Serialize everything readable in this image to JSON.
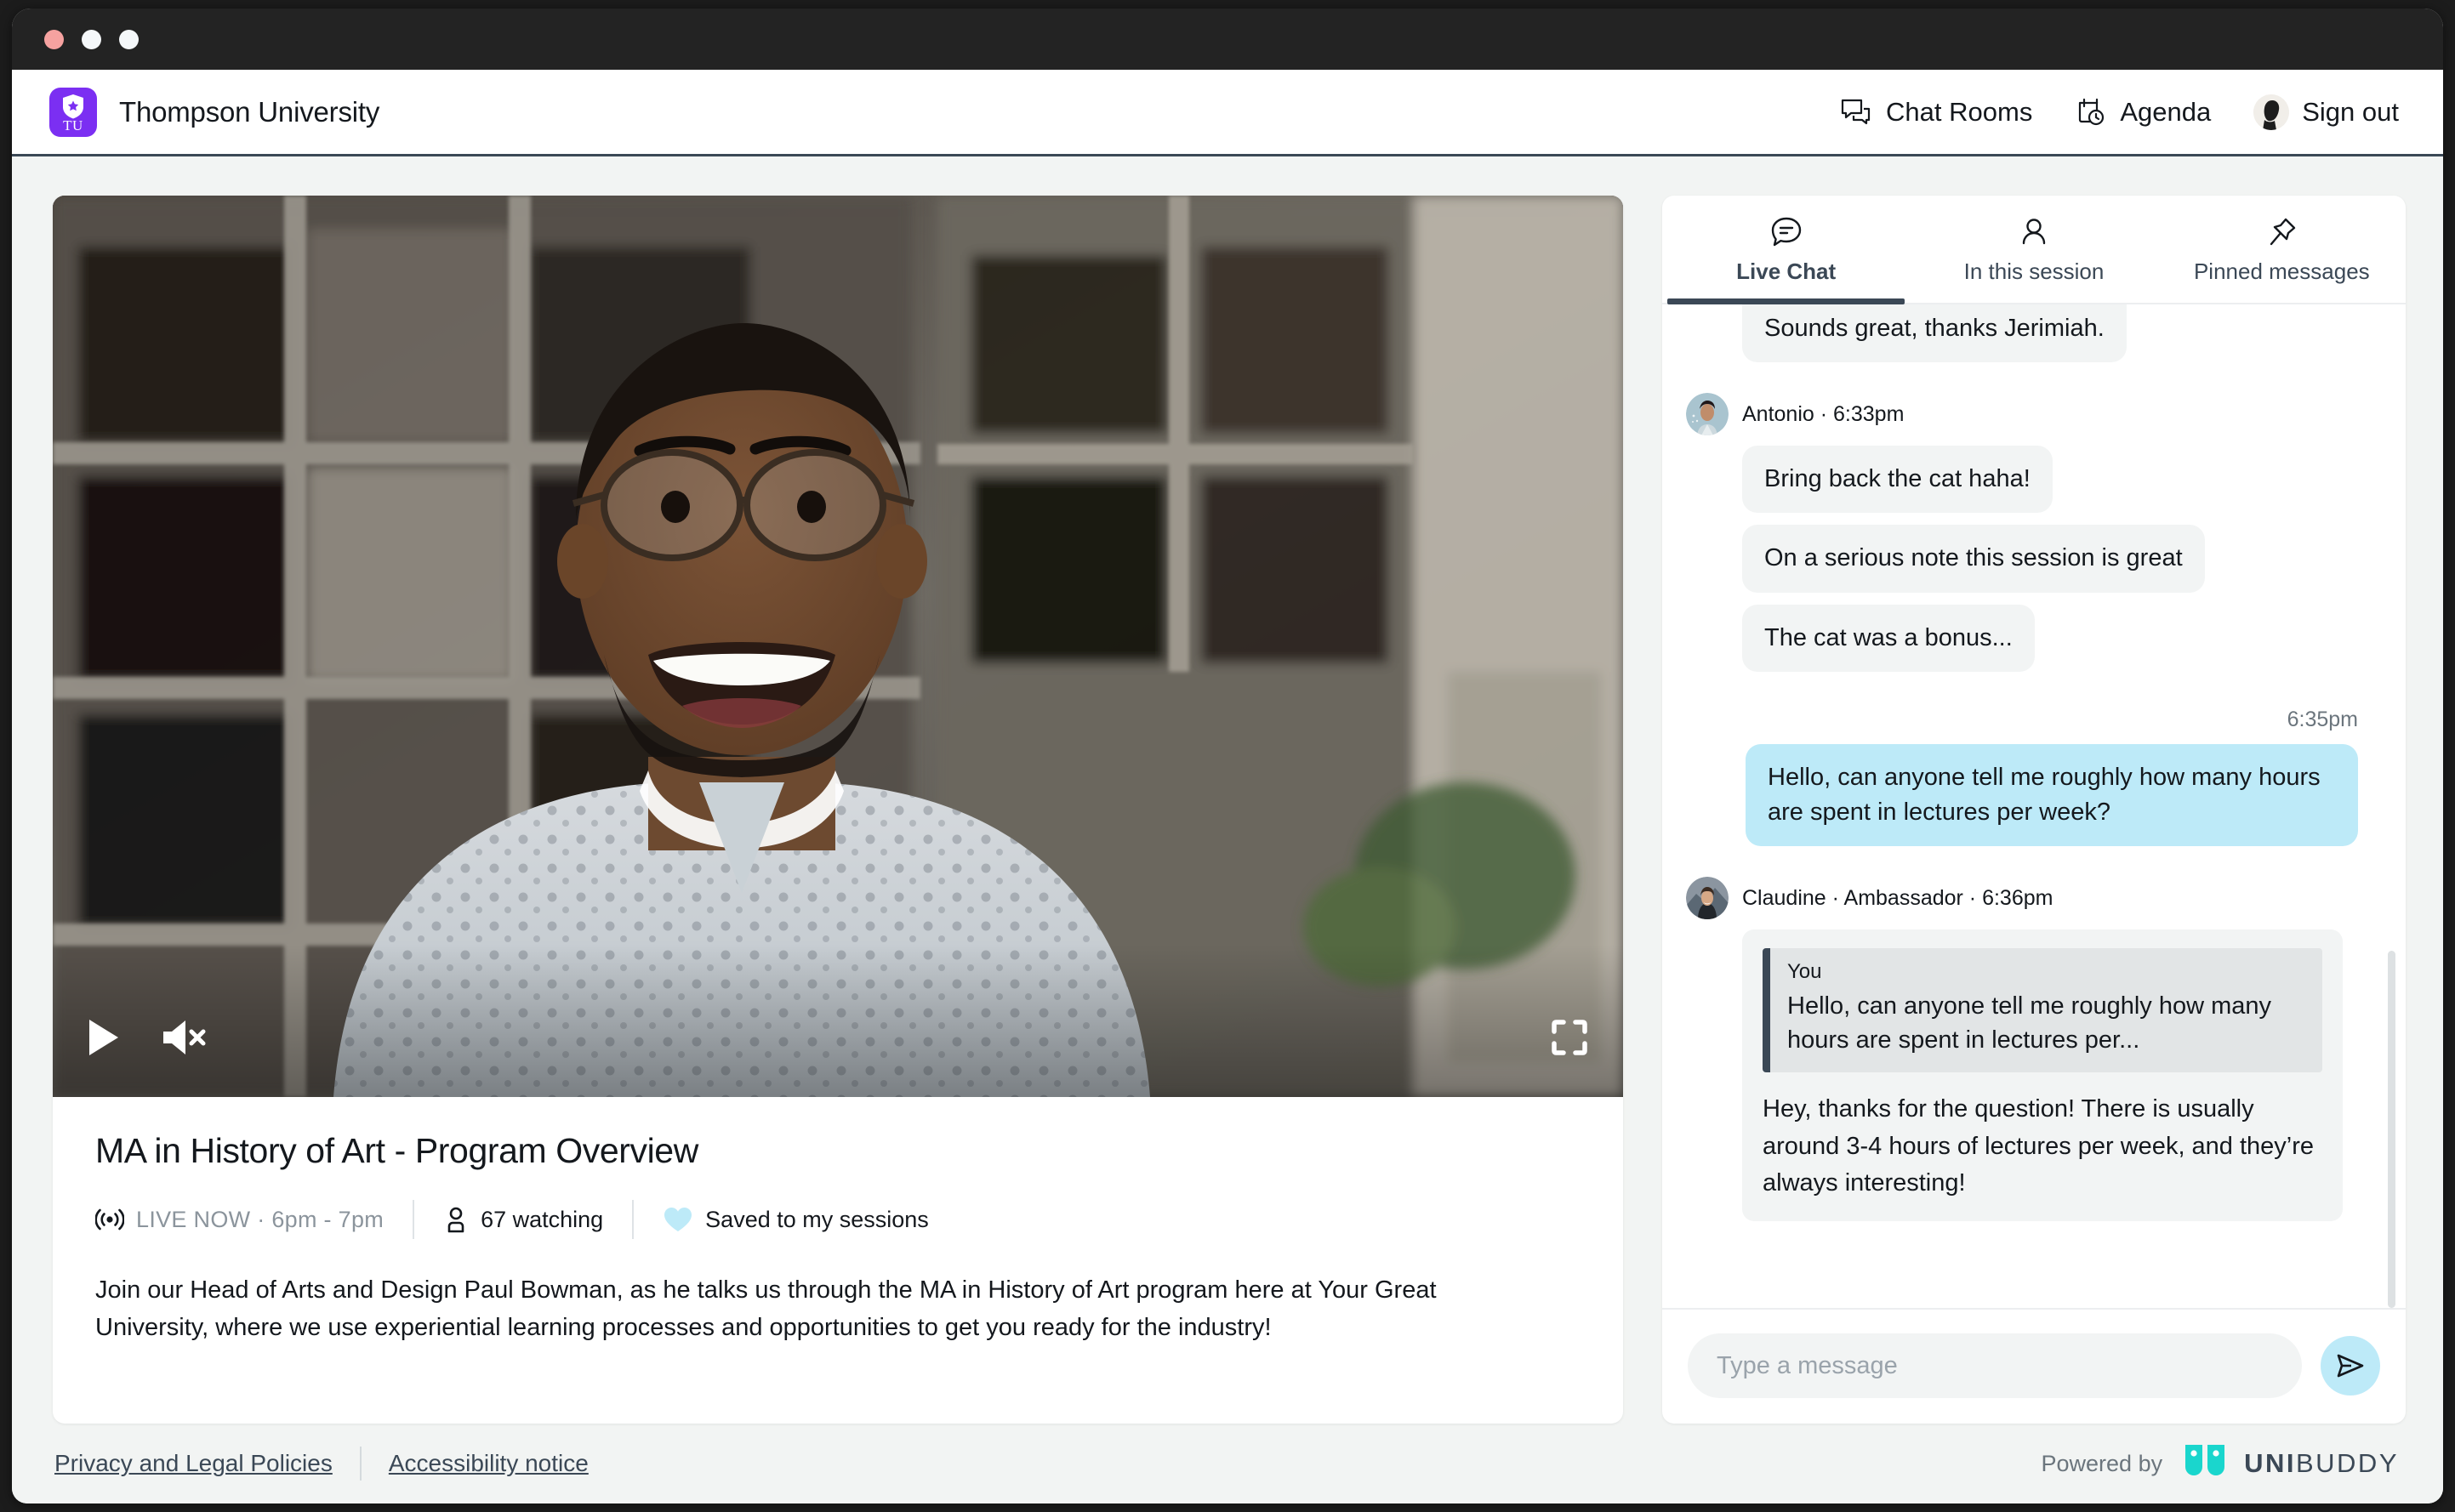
{
  "window": {
    "dots": [
      "close",
      "minimize",
      "maximize"
    ]
  },
  "header": {
    "brand_name": "Thompson University",
    "logo_text": "TU",
    "nav": [
      {
        "label": "Chat Rooms",
        "icon": "chat-rooms-icon"
      },
      {
        "label": "Agenda",
        "icon": "agenda-icon"
      },
      {
        "label": "Sign out",
        "icon": "user-avatar-icon"
      }
    ]
  },
  "video": {
    "controls": {
      "play": "play-icon",
      "mute": "volume-muted-icon",
      "fullscreen": "fullscreen-icon"
    },
    "title": "MA in History of Art - Program Overview",
    "live_label": "LIVE NOW",
    "time_range": "6pm - 7pm",
    "live_meta": "LIVE NOW · 6pm - 7pm",
    "watching": "67 watching",
    "saved": "Saved to my sessions",
    "description": "Join our Head of Arts and Design Paul Bowman, as he talks us through the MA in History of Art program here at Your Great University, where we use experiential learning processes and opportunities to get you ready for the industry!"
  },
  "chat": {
    "tabs": [
      {
        "label": "Live Chat",
        "icon": "chat-bubble-icon",
        "active": true
      },
      {
        "label": "In this session",
        "icon": "person-icon",
        "active": false
      },
      {
        "label": "Pinned messages",
        "icon": "pin-icon",
        "active": false
      }
    ],
    "messages": {
      "m0": {
        "text": "Sounds great, thanks Jerimiah."
      },
      "m1": {
        "sender": "Antonio",
        "time": "6:33pm",
        "meta": "Antonio · 6:33pm",
        "b1": "Bring back the cat haha!",
        "b2": "On a serious note this session is great",
        "b3": "The cat was a bonus..."
      },
      "m2": {
        "time": "6:35pm",
        "text": "Hello, can anyone tell me roughly how many hours are spent in lectures per week?"
      },
      "m3": {
        "sender": "Claudine",
        "role": "Ambassador",
        "time": "6:36pm",
        "meta": "Claudine · Ambassador · 6:36pm",
        "quote_name": "You",
        "quote_text": "Hello, can anyone tell me roughly how many hours are spent in lectures per...",
        "text": "Hey, thanks for the question! There is usually around 3-4 hours of lectures per week, and they’re always interesting!"
      }
    },
    "composer": {
      "placeholder": "Type a message",
      "send_icon": "send-icon"
    }
  },
  "footer": {
    "links": [
      {
        "label": "Privacy and Legal Policies"
      },
      {
        "label": "Accessibility notice"
      }
    ],
    "powered_by": "Powered by",
    "brand_prefix": "UNI",
    "brand_suffix": "BUDDY"
  },
  "colors": {
    "accent_purple": "#7b2ff2",
    "bubble_mine": "#bdeaf8",
    "bubble_other": "#f2f4f4",
    "dark_slate": "#3b4856",
    "unibuddy_teal": "#1ad6cd"
  }
}
